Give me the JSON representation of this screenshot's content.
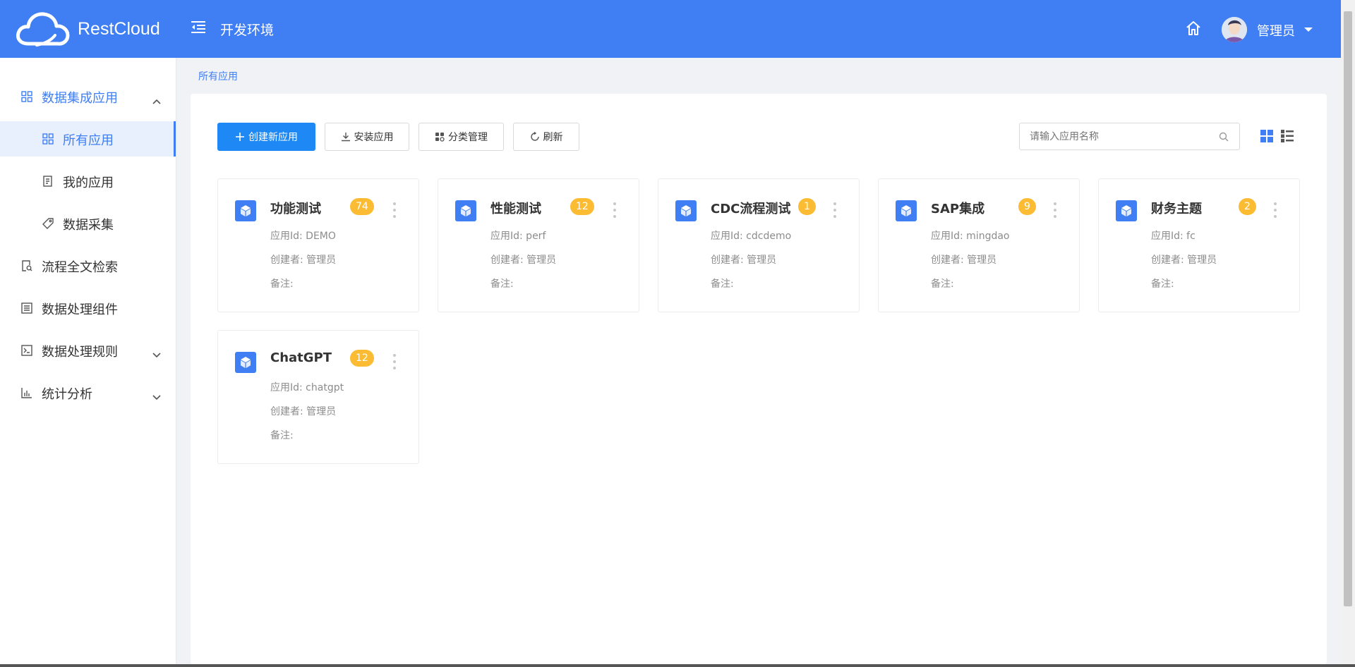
{
  "header": {
    "logo_text": "RestCloud",
    "env_title": "开发环境",
    "user_name": "管理员"
  },
  "colors": {
    "primary": "#3f7ef3",
    "button_blue": "#1e88f5",
    "badge": "#fbbc34"
  },
  "sidebar": {
    "items": [
      {
        "label": "数据集成应用",
        "icon": "grid-icon"
      },
      {
        "label": "所有应用",
        "icon": "grid-icon"
      },
      {
        "label": "我的应用",
        "icon": "document-icon"
      },
      {
        "label": "数据采集",
        "icon": "tag-icon"
      },
      {
        "label": "流程全文检索",
        "icon": "document-search-icon"
      },
      {
        "label": "数据处理组件",
        "icon": "list-doc-icon"
      },
      {
        "label": "数据处理规则",
        "icon": "terminal-icon"
      },
      {
        "label": "统计分析",
        "icon": "bar-chart-icon"
      }
    ]
  },
  "breadcrumb": "所有应用",
  "toolbar": {
    "create_label": "创建新应用",
    "install_label": "安装应用",
    "category_label": "分类管理",
    "refresh_label": "刷新",
    "search_placeholder": "请输入应用名称"
  },
  "cards": [
    {
      "name": "功能测试",
      "badge": "74",
      "app_id": "应用Id: DEMO",
      "creator": "创建者: 管理员",
      "note": "备注:"
    },
    {
      "name": "性能测试",
      "badge": "12",
      "app_id": "应用Id: perf",
      "creator": "创建者: 管理员",
      "note": "备注:"
    },
    {
      "name": "CDC流程测试",
      "badge": "1",
      "app_id": "应用Id: cdcdemo",
      "creator": "创建者: 管理员",
      "note": "备注:"
    },
    {
      "name": "SAP集成",
      "badge": "9",
      "app_id": "应用Id: mingdao",
      "creator": "创建者: 管理员",
      "note": "备注:"
    },
    {
      "name": "财务主题",
      "badge": "2",
      "app_id": "应用Id: fc",
      "creator": "创建者: 管理员",
      "note": "备注:"
    },
    {
      "name": "ChatGPT",
      "badge": "12",
      "app_id": "应用Id: chatgpt",
      "creator": "创建者: 管理员",
      "note": "备注:"
    }
  ]
}
